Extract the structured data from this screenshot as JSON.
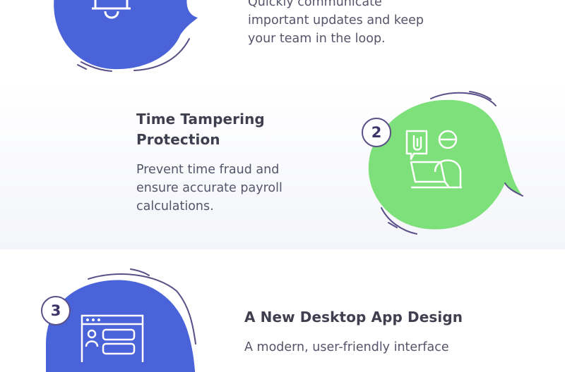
{
  "features": [
    {
      "description_lines": [
        "Quickly communicate",
        "important updates and keep",
        "your team in the loop."
      ],
      "icon": "bell-icon",
      "color": "#4a63d8"
    },
    {
      "number": "2",
      "title_lines": [
        "Time Tampering",
        "Protection"
      ],
      "description_lines": [
        "Prevent time fraud and",
        "ensure accurate payroll",
        "calculations."
      ],
      "icon": "time-tampering-icon",
      "color": "#7ee07a"
    },
    {
      "number": "3",
      "title_lines": [
        "A New Desktop App Design"
      ],
      "description_lines": [
        "A modern, user-friendly interface"
      ],
      "icon": "desktop-app-icon",
      "color": "#4a63d8"
    }
  ]
}
